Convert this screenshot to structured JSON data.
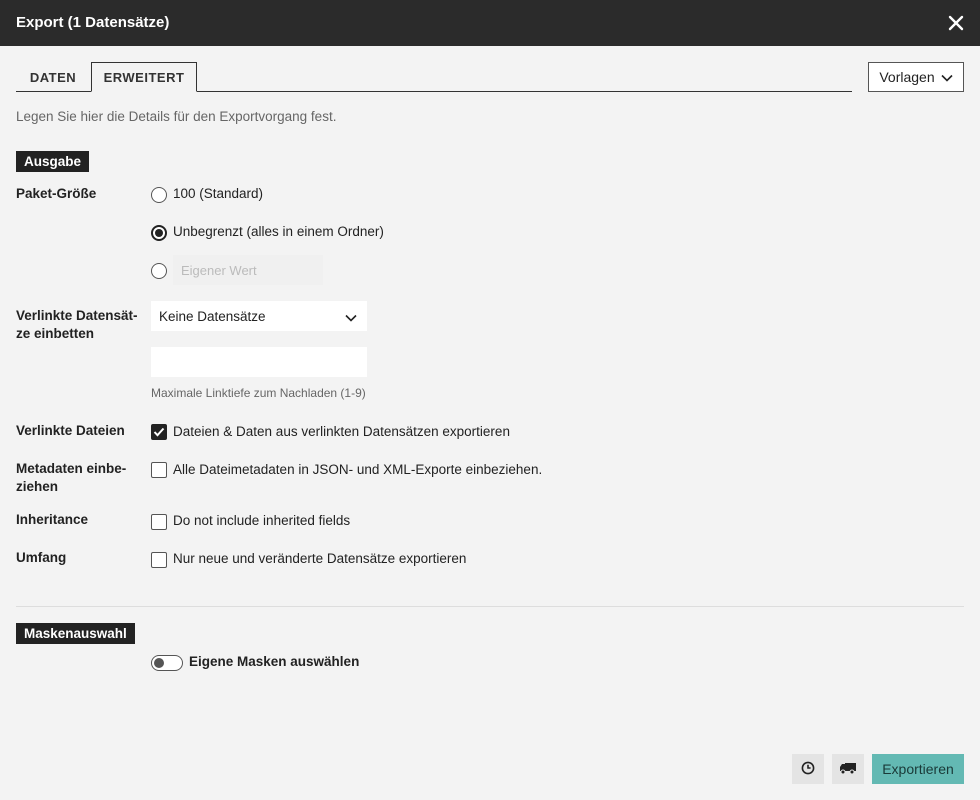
{
  "dialog": {
    "title": "Export (1 Datensätze)"
  },
  "tabs": [
    {
      "label": "Daten",
      "active": false
    },
    {
      "label": "Erweitert",
      "active": true
    }
  ],
  "templates_button": {
    "label": "Vorlagen"
  },
  "intro": "Legen Sie hier die Details für den Exportvorgang fest.",
  "sections": {
    "output": "Ausgabe",
    "mask": "Maskenauswahl"
  },
  "package_size": {
    "label": "Paket-Größe",
    "options": [
      {
        "label": "100 (Standard)",
        "selected": false
      },
      {
        "label": "Unbegrenzt (alles in einem Ordner)",
        "selected": true
      }
    ],
    "custom_placeholder": "Eigener Wert"
  },
  "linked_records": {
    "label": "Verlinkte Datensät-ze einbetten",
    "select_value": "Keine Datensätze",
    "depth_value": "",
    "hint": "Maximale Linktiefe zum Nachladen (1-9)"
  },
  "linked_files": {
    "label": "Verlinkte Dateien",
    "option": "Dateien & Daten aus verlinkten Datensätzen exportieren",
    "checked": true
  },
  "metadata": {
    "label": "Metadaten einbe-ziehen",
    "option": "Alle Dateimetadaten in JSON- und XML-Exporte einbeziehen.",
    "checked": false
  },
  "inheritance": {
    "label": "Inheritance",
    "option": "Do not include inherited fields",
    "checked": false
  },
  "scope": {
    "label": "Umfang",
    "option": "Nur neue und veränderte Datensätze exportieren",
    "checked": false
  },
  "mask_toggle": {
    "label": "Eigene Masken auswählen",
    "on": false
  },
  "footer": {
    "icons": [
      "clock-icon",
      "truck-icon"
    ],
    "export_label": "Exportieren"
  },
  "colors": {
    "titlebar": "#2b2b2b",
    "accent": "#63b9b3",
    "background": "#f3f3f3"
  }
}
